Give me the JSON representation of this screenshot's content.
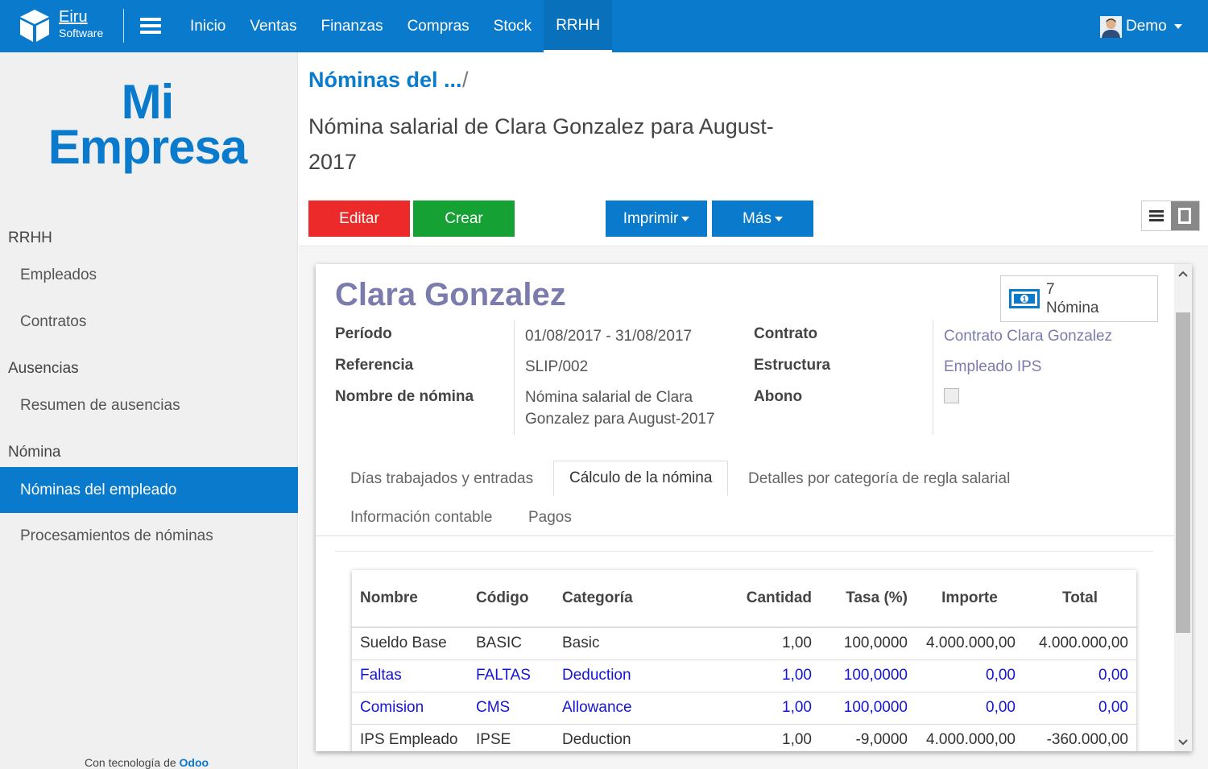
{
  "topbar": {
    "brand_name": "Eiru",
    "brand_sub": "Software",
    "menu": [
      {
        "label": "Inicio"
      },
      {
        "label": "Ventas"
      },
      {
        "label": "Finanzas"
      },
      {
        "label": "Compras"
      },
      {
        "label": "Stock"
      },
      {
        "label": "RRHH",
        "active": true
      }
    ],
    "user": "Demo"
  },
  "sidebar": {
    "logo_line1": "Mi",
    "logo_line2": "Empresa",
    "sections": [
      {
        "title": "RRHH",
        "items": [
          {
            "label": "Empleados"
          },
          {
            "label": "Contratos"
          }
        ]
      },
      {
        "title": "Ausencias",
        "items": [
          {
            "label": "Resumen de ausencias"
          }
        ]
      },
      {
        "title": "Nómina",
        "items": [
          {
            "label": "Nóminas del empleado",
            "active": true
          },
          {
            "label": "Procesamientos de nóminas"
          }
        ]
      }
    ],
    "powered_prefix": "Con tecnología de",
    "powered_brand": "Odoo"
  },
  "control": {
    "breadcrumb": "Nóminas del ...",
    "breadcrumb_sep": "/",
    "record_title": "Nómina salarial de Clara Gonzalez para August-2017",
    "buttons": {
      "edit": "Editar",
      "create": "Crear",
      "print": "Imprimir",
      "more": "Más"
    },
    "colors": {
      "edit": "#ec2a2a",
      "create": "#15a134",
      "print": "#0a7acd",
      "more": "#0a7acd"
    }
  },
  "form": {
    "employee": "Clara Gonzalez",
    "smart_button": {
      "count": "7",
      "label": "Nómina",
      "icon": "money-icon"
    },
    "fields": {
      "period_label": "Período",
      "period_from": "01/08/2017",
      "period_sep": "-",
      "period_to": "31/08/2017",
      "reference_label": "Referencia",
      "reference": "SLIP/002",
      "name_label": "Nombre de nómina",
      "name": "Nómina salarial de Clara Gonzalez para August-2017",
      "contract_label": "Contrato",
      "contract": "Contrato Clara Gonzalez",
      "structure_label": "Estructura",
      "structure": "Empleado IPS",
      "credit_label": "Abono",
      "credit": false
    },
    "tabs": [
      {
        "label": "Días trabajados y entradas"
      },
      {
        "label": "Cálculo de la nómina",
        "active": true
      },
      {
        "label": "Detalles por categoría de regla salarial"
      },
      {
        "label": "Información contable"
      },
      {
        "label": "Pagos"
      }
    ],
    "table": {
      "headers": [
        "Nombre",
        "Código",
        "Categoría",
        "Cantidad",
        "Tasa (%)",
        "Importe",
        "Total"
      ],
      "rows": [
        {
          "name": "Sueldo Base",
          "code": "BASIC",
          "category": "Basic",
          "qty": "1,00",
          "rate": "100,0000",
          "amount": "4.000.000,00",
          "total": "4.000.000,00",
          "highlight": false
        },
        {
          "name": "Faltas",
          "code": "FALTAS",
          "category": "Deduction",
          "qty": "1,00",
          "rate": "100,0000",
          "amount": "0,00",
          "total": "0,00",
          "highlight": true
        },
        {
          "name": "Comision",
          "code": "CMS",
          "category": "Allowance",
          "qty": "1,00",
          "rate": "100,0000",
          "amount": "0,00",
          "total": "0,00",
          "highlight": true
        },
        {
          "name": "IPS Empleado",
          "code": "IPSE",
          "category": "Deduction",
          "qty": "1,00",
          "rate": "-9,0000",
          "amount": "4.000.000,00",
          "total": "-360.000,00",
          "highlight": false
        }
      ]
    }
  }
}
